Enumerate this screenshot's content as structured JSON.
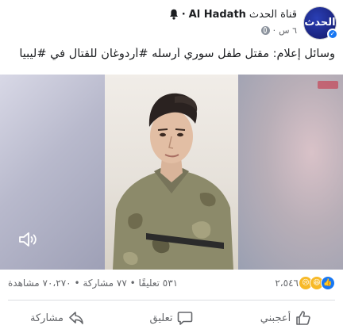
{
  "header": {
    "page_name_ar": "قناة الحدث",
    "page_name_en": "Al Hadath",
    "separator": "·",
    "time_ago": "٦ س",
    "meta_separator": "·",
    "avatar_logo_text": "الحدث"
  },
  "post": {
    "text": "وسائل إعلام: مقتل طفل سوري أرسله #أردوغان للقتال في #ليبيا"
  },
  "engagement": {
    "reactions": [
      "like-icon",
      "haha-icon",
      "sad-icon"
    ],
    "reaction_count": "٢،٥٤٦",
    "stats_text": "٥٣١ تعليقًا • ٧٧ مشاركة • ٧٠،٢٧٠ مشاهدة"
  },
  "actions": {
    "like_label": "أعجبني",
    "comment_label": "تعليق",
    "share_label": "مشاركة"
  },
  "colors": {
    "like_blue": "#1877f2",
    "secondary_text": "#65676b",
    "primary_text": "#1c1e21"
  }
}
